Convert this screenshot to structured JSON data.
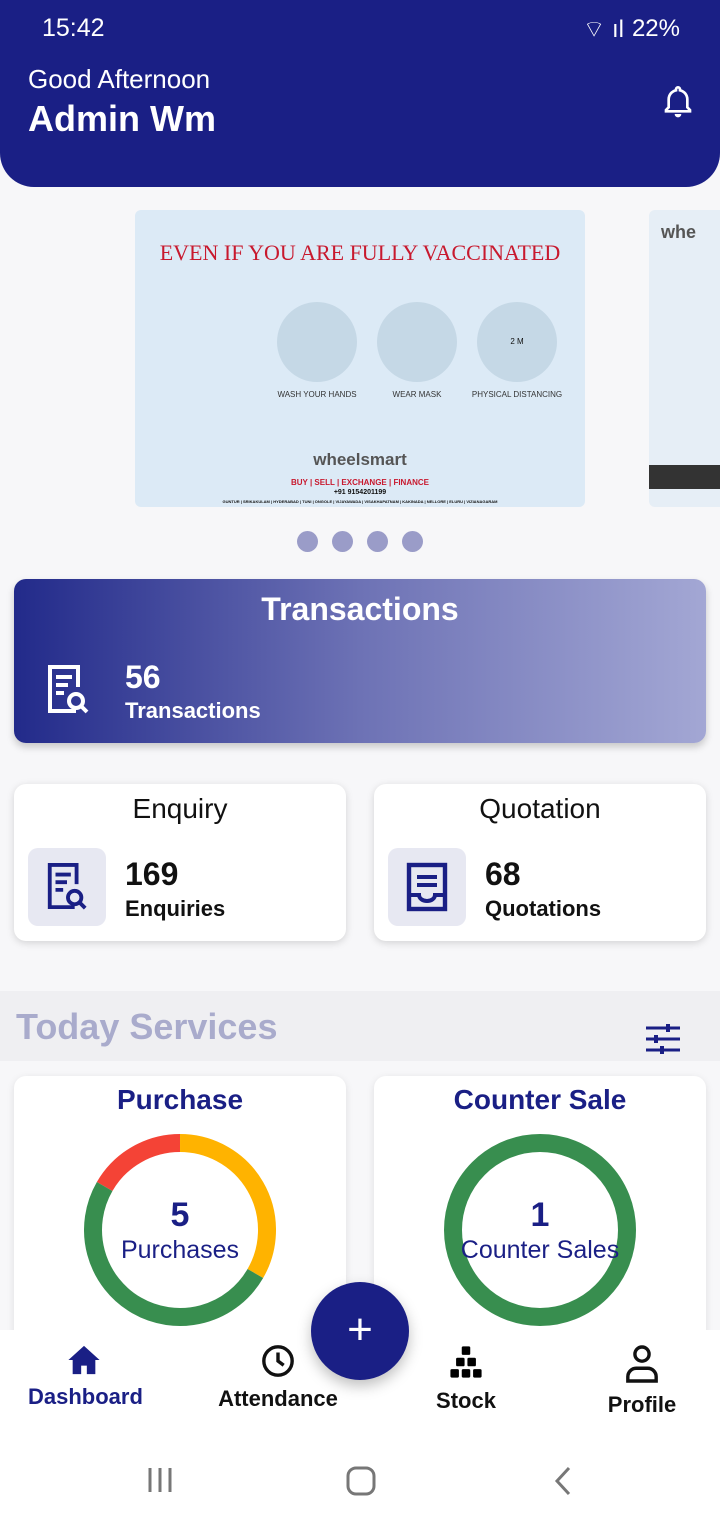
{
  "status_bar": {
    "time": "15:42",
    "battery": "22%"
  },
  "header": {
    "greeting": "Good Afternoon",
    "user_name": "Admin Wm"
  },
  "banner": {
    "title": "EVEN IF YOU ARE FULLY VACCINATED",
    "captions": [
      "WASH YOUR HANDS",
      "WEAR MASK",
      "PHYSICAL DISTANCING"
    ],
    "brand": "wheelsmart",
    "tagline": "BUY | SELL | EXCHANGE | FINANCE",
    "phone": "+91 9154201199",
    "cities": "GUNTUR | SRIKAKULAM | HYDERABAD | TUNI | ONGOLE | VIJAYAWADA | VISAKHAPATNAM | KAKINADA | NELLORE | ELURU | VIZIANAGARAM",
    "distance_label": "2 M",
    "next_banner_text": "whe",
    "page_count": 4
  },
  "transactions": {
    "title": "Transactions",
    "count": "56",
    "label": "Transactions"
  },
  "enquiry": {
    "title": "Enquiry",
    "count": "169",
    "label": "Enquiries"
  },
  "quotation": {
    "title": "Quotation",
    "count": "68",
    "label": "Quotations"
  },
  "today_services": {
    "title": "Today Services"
  },
  "purchase": {
    "title": "Purchase",
    "count": "5",
    "label": "Purchases",
    "segments": [
      {
        "color": "#f44336",
        "fraction": 0.1667
      },
      {
        "color": "#ffb300",
        "fraction": 0.3333
      },
      {
        "color": "#388e4f",
        "fraction": 0.5
      }
    ]
  },
  "counter_sale": {
    "title": "Counter Sale",
    "count": "1",
    "label": "Counter Sales",
    "segments": [
      {
        "color": "#388e4f",
        "fraction": 1
      }
    ]
  },
  "nav": {
    "items": [
      {
        "label": "Dashboard",
        "icon": "home-icon",
        "active": true
      },
      {
        "label": "Attendance",
        "icon": "clock-icon"
      },
      {
        "label": "Stock",
        "icon": "boxes-icon"
      },
      {
        "label": "Profile",
        "icon": "person-icon"
      }
    ],
    "fab": "+"
  },
  "colors": {
    "primary": "#1a1f85"
  }
}
